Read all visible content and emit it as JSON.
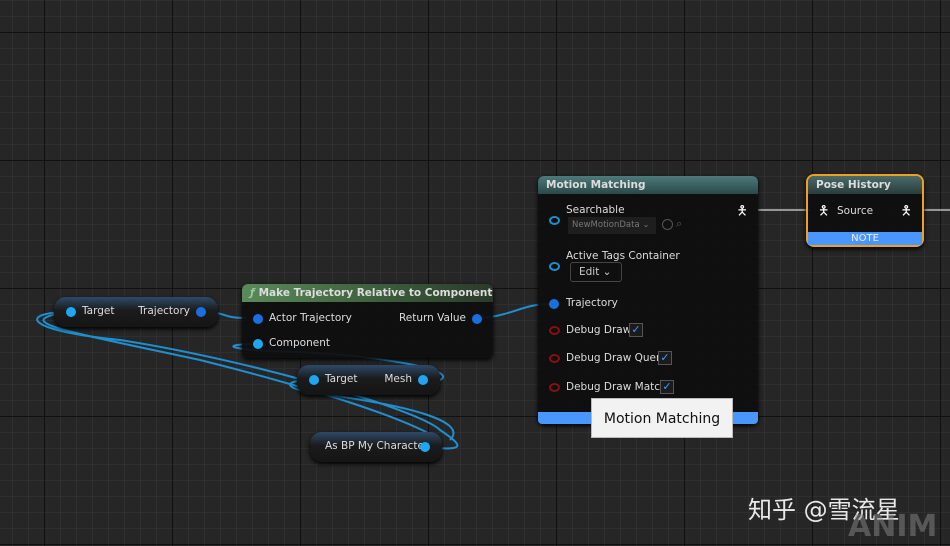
{
  "nodes": {
    "get_trajectory": {
      "in": "Target",
      "out": "Trajectory"
    },
    "make_traj": {
      "title": "Make Trajectory Relative to Component",
      "func_icon": "ƒ",
      "in1": "Actor Trajectory",
      "in2": "Component",
      "out": "Return Value"
    },
    "get_mesh": {
      "in": "Target",
      "out": "Mesh"
    },
    "cast": {
      "label": "As BP My Character"
    },
    "motion_matching": {
      "title": "Motion Matching",
      "searchable": "Searchable",
      "searchable_value": "NewMotionData",
      "active_tags": "Active Tags Container",
      "edit": "Edit",
      "trajectory": "Trajectory",
      "debug_draw": "Debug Draw",
      "debug_draw_query": "Debug Draw Query",
      "debug_draw_match": "Debug Draw Match",
      "footer_tooltip": "Motion Matching"
    },
    "pose_history": {
      "title": "Pose History",
      "source": "Source",
      "note": "NOTE"
    }
  },
  "watermark": {
    "text": "知乎 @雪流星",
    "partial": "ANIM"
  },
  "colors": {
    "accent": "#4a96ff",
    "selected": "#f0a020",
    "pin": "#1ea7f0"
  }
}
